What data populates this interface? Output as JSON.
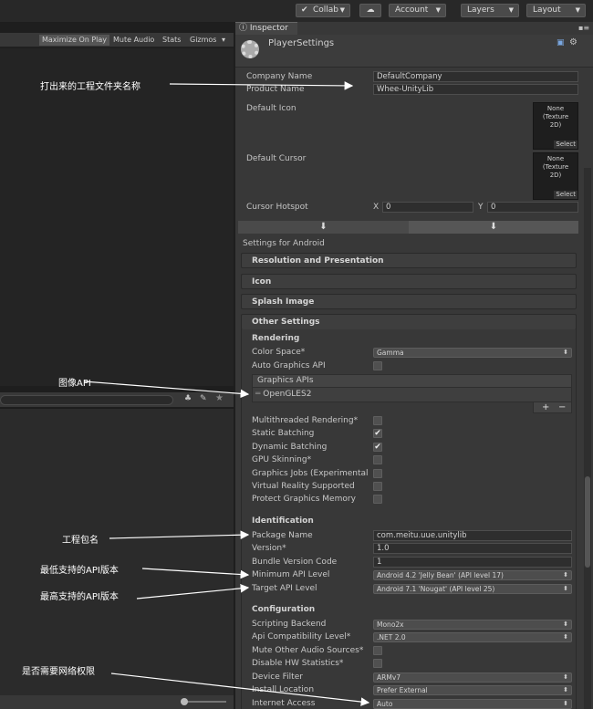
{
  "toolbar": {
    "collab": "Collab",
    "account": "Account",
    "layers": "Layers",
    "layout": "Layout"
  },
  "game_view": {
    "maximize": "Maximize On Play",
    "mute": "Mute Audio",
    "stats": "Stats",
    "gizmos": "Gizmos"
  },
  "inspector": {
    "tab": "Inspector",
    "title": "PlayerSettings",
    "company_label": "Company Name",
    "company_value": "DefaultCompany",
    "product_label": "Product Name",
    "product_value": "Whee-UnityLib",
    "default_icon_label": "Default Icon",
    "default_cursor_label": "Default Cursor",
    "texture_none": "None",
    "texture_type": "(Texture",
    "texture_2d": "2D)",
    "select": "Select",
    "cursor_hotspot_label": "Cursor Hotspot",
    "hotspot_x_label": "X",
    "hotspot_x": "0",
    "hotspot_y_label": "Y",
    "hotspot_y": "0",
    "settings_for": "Settings for Android",
    "sections": [
      "Resolution and Presentation",
      "Icon",
      "Splash Image",
      "Other Settings"
    ],
    "rendering_header": "Rendering",
    "color_space_label": "Color Space*",
    "color_space_value": "Gamma",
    "auto_graphics_label": "Auto Graphics API",
    "graphics_apis_header": "Graphics APIs",
    "graphics_api_item": "OpenGLES2",
    "add": "+",
    "remove": "−",
    "multithreaded_label": "Multithreaded Rendering*",
    "static_batching_label": "Static Batching",
    "dynamic_batching_label": "Dynamic Batching",
    "gpu_skinning_label": "GPU Skinning*",
    "graphics_jobs_label": "Graphics Jobs (Experimental",
    "vr_label": "Virtual Reality Supported",
    "protect_label": "Protect Graphics Memory",
    "identification_header": "Identification",
    "package_label": "Package Name",
    "package_value": "com.meitu.uue.unitylib",
    "version_label": "Version*",
    "version_value": "1.0",
    "bundle_label": "Bundle Version Code",
    "bundle_value": "1",
    "min_api_label": "Minimum API Level",
    "min_api_value": "Android 4.2 'Jelly Bean' (API level 17)",
    "target_api_label": "Target API Level",
    "target_api_value": "Android 7.1 'Nougat' (API level 25)",
    "configuration_header": "Configuration",
    "scripting_label": "Scripting Backend",
    "scripting_value": "Mono2x",
    "api_compat_label": "Api Compatibility Level*",
    "api_compat_value": ".NET 2.0",
    "mute_audio_label": "Mute Other Audio Sources*",
    "disable_hw_label": "Disable HW Statistics*",
    "device_filter_label": "Device Filter",
    "device_filter_value": "ARMv7",
    "install_label": "Install Location",
    "install_value": "Prefer External",
    "internet_label": "Internet Access",
    "internet_value": "Auto"
  },
  "annotations": {
    "project_folder": "打出来的工程文件夹名称",
    "graphics_api": "图像API",
    "package_name": "工程包名",
    "min_api": "最低支持的API版本",
    "max_api": "最高支持的API版本",
    "network": "是否需要网络权限"
  }
}
